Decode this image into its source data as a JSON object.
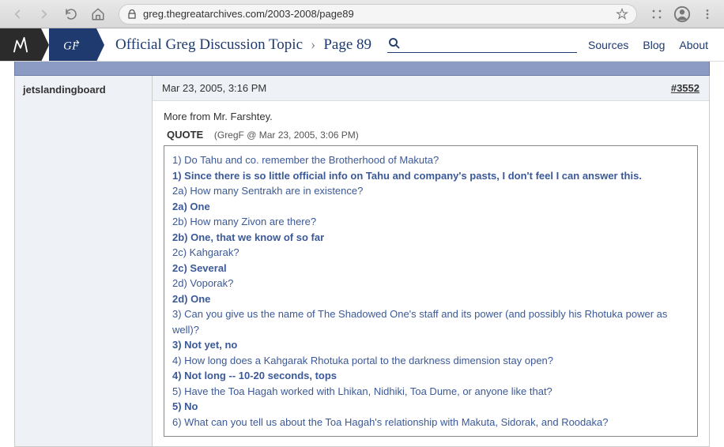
{
  "browser": {
    "url": "greg.thegreatarchives.com/2003-2008/page89"
  },
  "header": {
    "logo_text": "GF",
    "breadcrumb_topic": "Official Greg Discussion Topic",
    "breadcrumb_sep": "›",
    "breadcrumb_page": "Page 89",
    "links": {
      "sources": "Sources",
      "blog": "Blog",
      "about": "About"
    }
  },
  "post": {
    "username": "jetslandingboard",
    "date": "Mar 23, 2005, 3:16 PM",
    "number": "#3552",
    "intro": "More from Mr. Farshtey.",
    "quote_label": "QUOTE",
    "quote_meta": "(GregF @ Mar 23, 2005, 3:06 PM)",
    "lines": [
      {
        "t": "1) Do Tahu and co. remember the Brotherhood of Makuta?",
        "b": false
      },
      {
        "t": "1) Since there is so little official info on Tahu and company's pasts, I don't feel I can answer this.",
        "b": true
      },
      {
        "t": "2a) How many Sentrakh are in existence?",
        "b": false
      },
      {
        "t": "2a) One",
        "b": true
      },
      {
        "t": "2b) How many Zivon are there?",
        "b": false
      },
      {
        "t": "2b) One, that we know of so far",
        "b": true
      },
      {
        "t": "2c) Kahgarak?",
        "b": false
      },
      {
        "t": "2c) Several",
        "b": true
      },
      {
        "t": "2d) Voporak?",
        "b": false
      },
      {
        "t": "2d) One",
        "b": true
      },
      {
        "t": "3) Can you give us the name of The Shadowed One's staff and its power (and possibly his Rhotuka power as well)?",
        "b": false
      },
      {
        "t": "3) Not yet, no",
        "b": true
      },
      {
        "t": "4) How long does a Kahgarak Rhotuka portal to the darkness dimension stay open?",
        "b": false
      },
      {
        "t": "4) Not long -- 10-20 seconds, tops",
        "b": true
      },
      {
        "t": "5) Have the Toa Hagah worked with Lhikan, Nidhiki, Toa Dume, or anyone like that?",
        "b": false
      },
      {
        "t": "5) No",
        "b": true
      },
      {
        "t": "6) What can you tell us about the Toa Hagah's relationship with Makuta, Sidorak, and Roodaka?",
        "b": false
      }
    ]
  }
}
